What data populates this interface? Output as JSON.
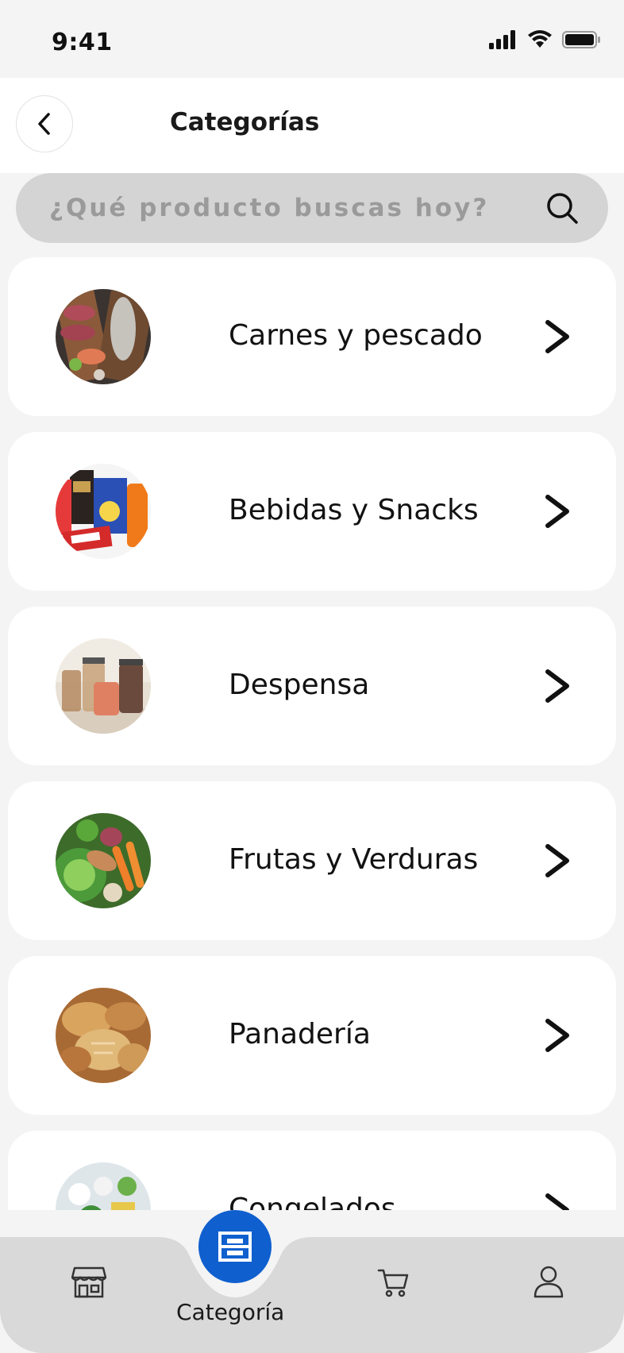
{
  "status_bar": {
    "time": "9:41"
  },
  "header": {
    "title": "Categorías"
  },
  "search": {
    "placeholder": "¿Qué producto buscas hoy?"
  },
  "categories": [
    {
      "label": "Carnes y pescado"
    },
    {
      "label": "Bebidas y Snacks"
    },
    {
      "label": "Despensa"
    },
    {
      "label": "Frutas y Verduras"
    },
    {
      "label": "Panadería"
    },
    {
      "label": "Congelados"
    }
  ],
  "bottom_nav": {
    "active_label": "Categoría",
    "items": [
      "store-icon",
      "category-icon",
      "cart-icon",
      "profile-icon"
    ]
  },
  "colors": {
    "accent": "#0f5fcf",
    "background": "#f4f4f4",
    "search_bg": "#d4d4d4"
  }
}
